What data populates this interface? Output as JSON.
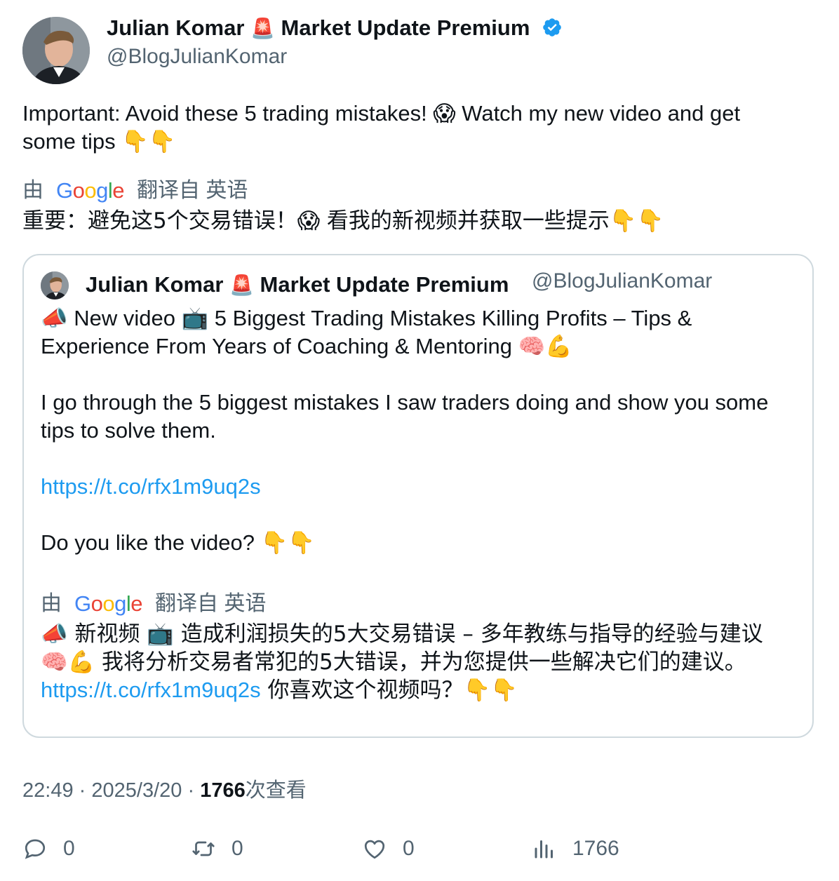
{
  "author": {
    "name_part1": "Julian Komar",
    "siren_emoji": "🚨",
    "name_part2": "Market Update Premium",
    "handle": "@BlogJulianKomar",
    "verified_icon": "verified-badge-icon"
  },
  "tweet": {
    "text_line1": "Important: Avoid these 5 trading mistakes! 😱 Watch my new video and get",
    "text_line2": "some tips 👇👇",
    "translated_prefix": "由",
    "google_logo": {
      "G": "G",
      "o1": "o",
      "o2": "o",
      "g": "g",
      "l": "l",
      "e": "e"
    },
    "translated_suffix": "翻译自 英语",
    "translation": "重要：避免这5个交易错误！😱 看我的新视频并获取一些提示👇👇"
  },
  "quote": {
    "name_part1": "Julian Komar",
    "siren_emoji": "🚨",
    "name_part2": "Market Update Premium",
    "handle": "@BlogJulianKomar",
    "line1": "📣 New video 📺 5 Biggest Trading Mistakes Killing Profits – Tips &",
    "line2": "Experience From Years of Coaching & Mentoring 🧠💪",
    "line3": "I go through the 5 biggest mistakes I saw traders doing and show you some",
    "line4": "tips to solve them.",
    "link": "https://t.co/rfx1m9uq2s",
    "line5": "Do you like the video? 👇👇",
    "translated_prefix": "由",
    "translated_suffix": "翻译自 英语",
    "translation_line1": "📣 新视频 📺 造成利润损失的5大交易错误 – 多年教练与指导的经验与建议",
    "translation_line2": "🧠💪 我将分析交易者常犯的5大错误，并为您提供一些解决它们的建议。",
    "translation_link": "https://t.co/rfx1m9uq2s",
    "translation_line3_rest": "你喜欢这个视频吗？👇👇"
  },
  "meta": {
    "time": "22:49",
    "separator": "·",
    "date": "2025/3/20",
    "views_count": "1766",
    "views_label": "次查看"
  },
  "actions": {
    "replies": "0",
    "retweets": "0",
    "likes": "0",
    "views": "1766"
  },
  "colors": {
    "link": "#1d9bf0",
    "secondary_text": "#536471",
    "border": "#cfd9de",
    "verified": "#1d9bf0"
  }
}
